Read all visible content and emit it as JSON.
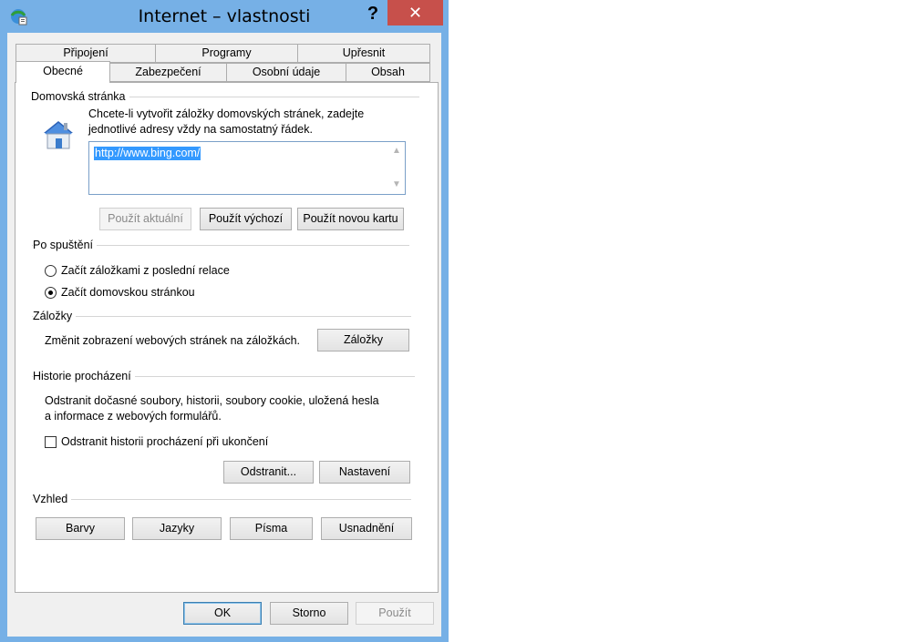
{
  "window": {
    "title": "Internet – vlastnosti",
    "help_label": "?",
    "close_label": "✕"
  },
  "tabs": {
    "row1": [
      "Připojení",
      "Programy",
      "Upřesnit"
    ],
    "row2": [
      "Obecné",
      "Zabezpečení",
      "Osobní údaje",
      "Obsah"
    ],
    "active": "Obecné"
  },
  "homepage": {
    "group_label": "Domovská stránka",
    "description_line1": "Chcete-li vytvořit záložky domovských stránek, zadejte",
    "description_line2": "jednotlivé adresy vždy na samostatný řádek.",
    "url_value": "http://www.bing.com/",
    "use_current_label": "Použít aktuální",
    "use_default_label": "Použít výchozí",
    "use_new_tab_label": "Použít novou kartu"
  },
  "startup": {
    "group_label": "Po spuštění",
    "option_last_session": "Začít záložkami z poslední relace",
    "option_homepage": "Začít domovskou stránkou",
    "selected": "homepage"
  },
  "tabs_group": {
    "group_label": "Záložky",
    "description": "Změnit zobrazení webových stránek na záložkách.",
    "button_label": "Záložky"
  },
  "history": {
    "group_label": "Historie procházení",
    "description_line1": "Odstranit dočasné soubory, historii, soubory cookie, uložená hesla",
    "description_line2": "a informace z webových formulářů.",
    "delete_on_exit_label": "Odstranit historii procházení při ukončení",
    "delete_on_exit_checked": false,
    "delete_label": "Odstranit...",
    "settings_label": "Nastavení"
  },
  "appearance": {
    "group_label": "Vzhled",
    "colors_label": "Barvy",
    "languages_label": "Jazyky",
    "fonts_label": "Písma",
    "accessibility_label": "Usnadnění"
  },
  "footer": {
    "ok_label": "OK",
    "cancel_label": "Storno",
    "apply_label": "Použít"
  },
  "colors": {
    "frame": "#76b0e6",
    "close_button": "#c7504b",
    "selection": "#3399ff"
  }
}
